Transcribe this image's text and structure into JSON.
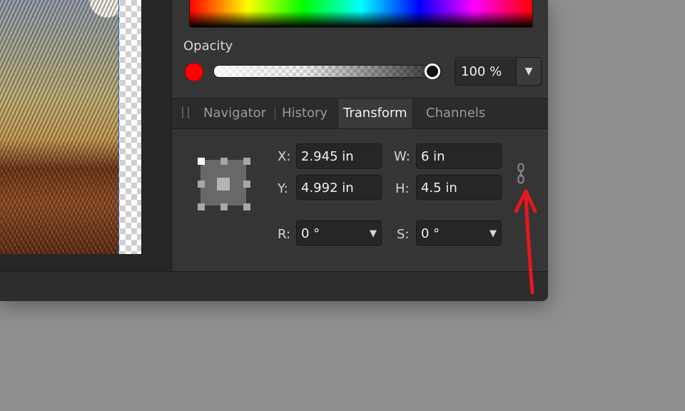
{
  "opacity": {
    "label": "Opacity",
    "value_text": "100 %",
    "level_fraction": 1.0,
    "swatch_color": "#ff0000",
    "dropdown_icon": "triangle-down-icon"
  },
  "tabs": [
    {
      "label": "Navigator",
      "active": false
    },
    {
      "label": "History",
      "active": false
    },
    {
      "label": "Transform",
      "active": true
    },
    {
      "label": "Channels",
      "active": false
    }
  ],
  "transform": {
    "x": {
      "label": "X:",
      "value": "2.945 in"
    },
    "y": {
      "label": "Y:",
      "value": "4.992 in"
    },
    "w": {
      "label": "W:",
      "value": "6 in"
    },
    "h": {
      "label": "H:",
      "value": "4.5 in"
    },
    "r": {
      "label": "R:",
      "value": "0 °"
    },
    "s": {
      "label": "S:",
      "value": "0 °"
    },
    "link_icon": "chain-link-icon",
    "anchor_icon": "anchor-point-selector-icon"
  },
  "annotation": {
    "color": "#e8161f",
    "icon": "red-arrow-annotation"
  }
}
